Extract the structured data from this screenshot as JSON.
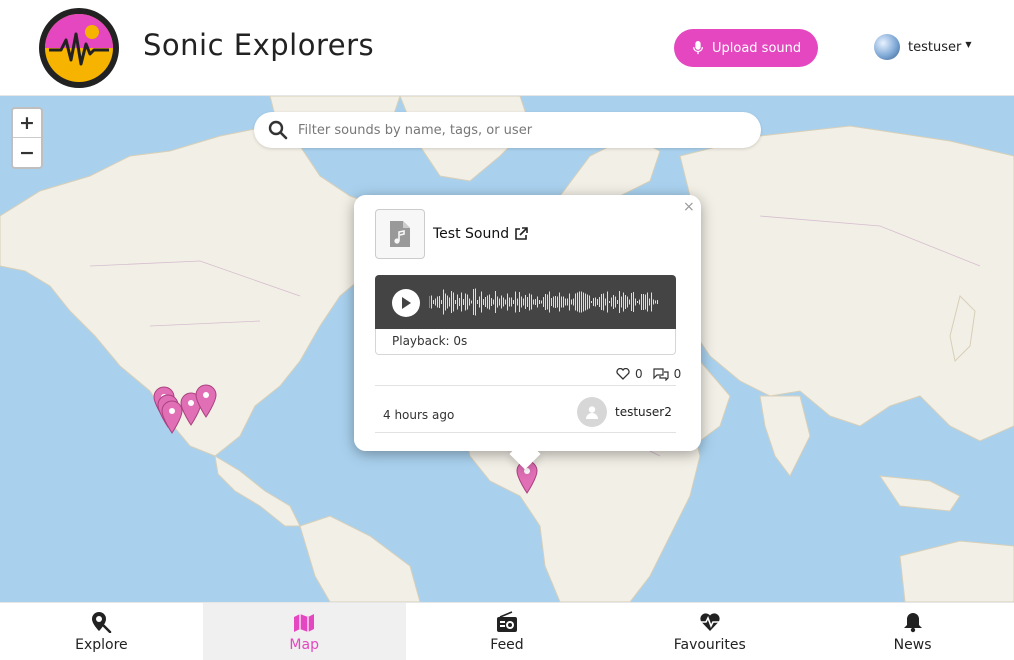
{
  "header": {
    "app_title": "Sonic Explorers",
    "upload_label": "Upload sound",
    "username": "testuser"
  },
  "map": {
    "zoom_in_label": "+",
    "zoom_out_label": "−",
    "search_placeholder": "Filter sounds by name, tags, or user"
  },
  "popup": {
    "close_label": "×",
    "sound_title": "Test Sound",
    "playback_label": "Playback: 0s",
    "likes": "0",
    "comments": "0",
    "time_ago": "4 hours ago",
    "author": "testuser2"
  },
  "nav": {
    "items": [
      {
        "label": "Explore",
        "icon": "map-search-icon"
      },
      {
        "label": "Map",
        "icon": "map-icon"
      },
      {
        "label": "Feed",
        "icon": "radio-icon"
      },
      {
        "label": "Favourites",
        "icon": "heartbeat-icon"
      },
      {
        "label": "News",
        "icon": "bell-icon"
      }
    ],
    "active_index": 1
  },
  "colors": {
    "accent": "#e447bf",
    "ocean": "#a9d1ee",
    "land": "#f2efe6",
    "marker": "#e06fb5"
  }
}
